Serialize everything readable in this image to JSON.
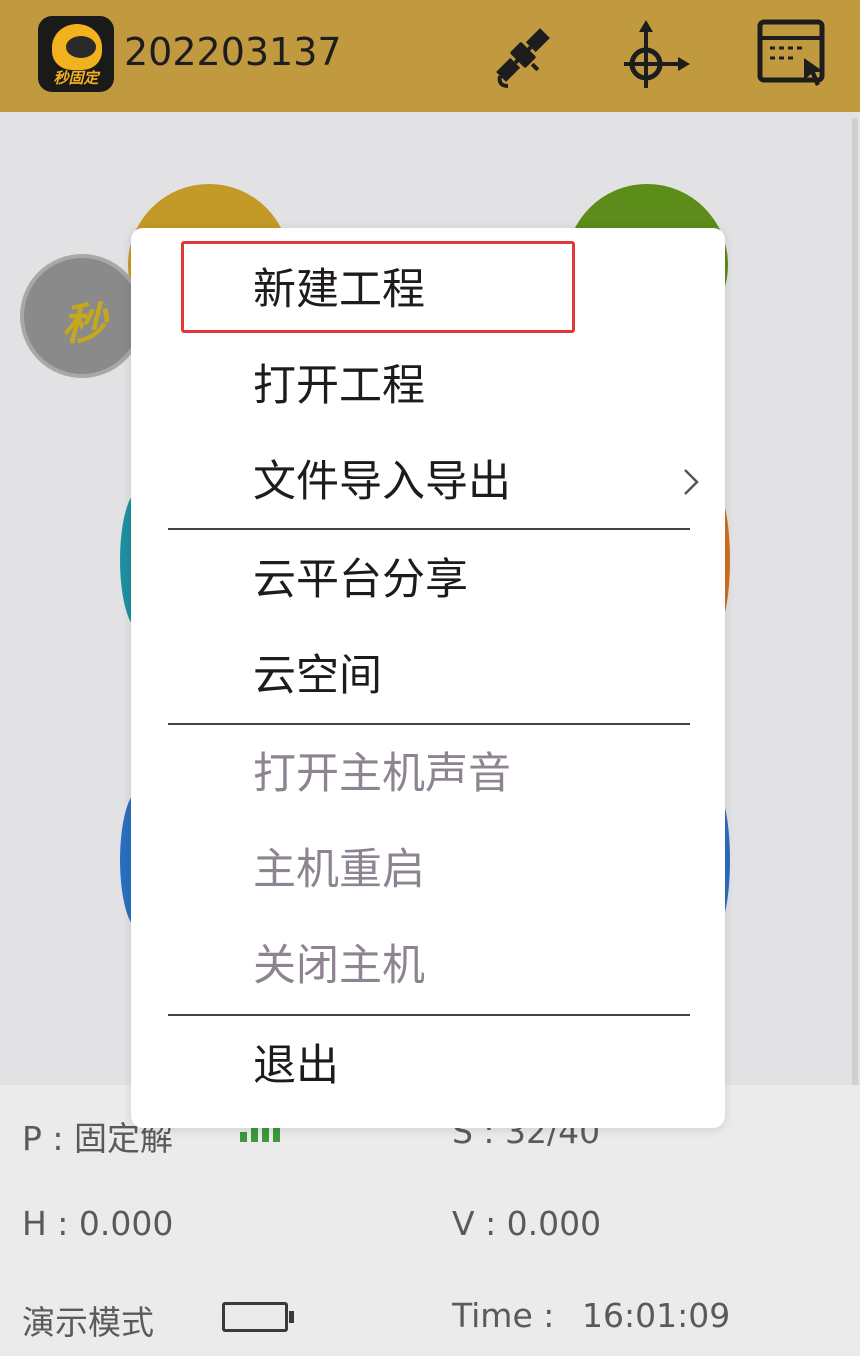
{
  "header": {
    "app_logo_text": "秒固定",
    "device_id": "202203137",
    "icons": [
      "satellite-icon",
      "crosshair-target-icon",
      "window-touch-icon"
    ],
    "background_color": "#c19a40"
  },
  "background_screen": {
    "float_button_text": "秒",
    "status": {
      "p_label": "P : 固定解",
      "s_label": "S : 32/40",
      "h_label": "H : 0.000",
      "v_label": "V : 0.000",
      "mode_label": "演示模式",
      "time_label": "Time :",
      "time_value": "16:01:09"
    }
  },
  "menu": {
    "items": [
      {
        "label": "新建工程",
        "enabled": true,
        "highlighted": true
      },
      {
        "label": "打开工程",
        "enabled": true
      },
      {
        "label": "文件导入导出",
        "enabled": true,
        "has_submenu": true
      },
      {
        "label": "云平台分享",
        "enabled": true
      },
      {
        "label": "云空间",
        "enabled": true
      },
      {
        "label": "打开主机声音",
        "enabled": false
      },
      {
        "label": "主机重启",
        "enabled": false
      },
      {
        "label": "关闭主机",
        "enabled": false
      },
      {
        "label": "退出",
        "enabled": true
      }
    ],
    "highlight_color": "#e4373a",
    "disabled_color": "#8e8491"
  }
}
